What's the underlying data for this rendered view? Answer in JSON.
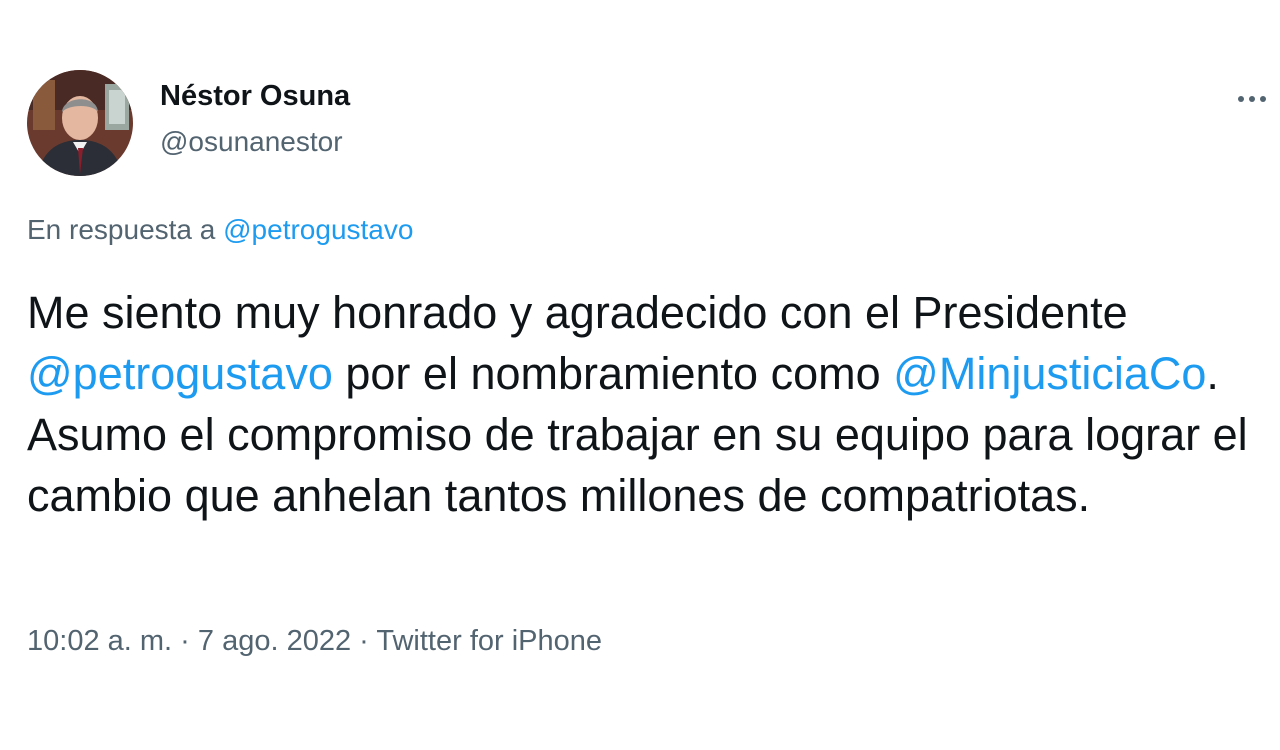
{
  "author": {
    "name": "Néstor Osuna",
    "handle": "@osunanestor"
  },
  "more_icon": "more-horizontal-icon",
  "reply": {
    "prefix": "En respuesta a",
    "mention": "@petrogustavo"
  },
  "body": {
    "segment_1": "Me siento muy honrado y agradecido con el Presidente",
    "mention_1": "@petrogustavo",
    "segment_2": "por el nombramiento como",
    "mention_2": "@MinjusticiaCo",
    "segment_3": ". Asumo el compromiso de trabajar en su equipo para lograr el cambio que anhelan tantos millones de compatriotas."
  },
  "meta": {
    "time": "10:02 a. m.",
    "separator_1": "·",
    "date": "7 ago. 2022",
    "separator_2": "·",
    "source": "Twitter for iPhone"
  },
  "colors": {
    "text": "#0f1419",
    "secondary": "#536471",
    "link": "#1d9bf0"
  }
}
